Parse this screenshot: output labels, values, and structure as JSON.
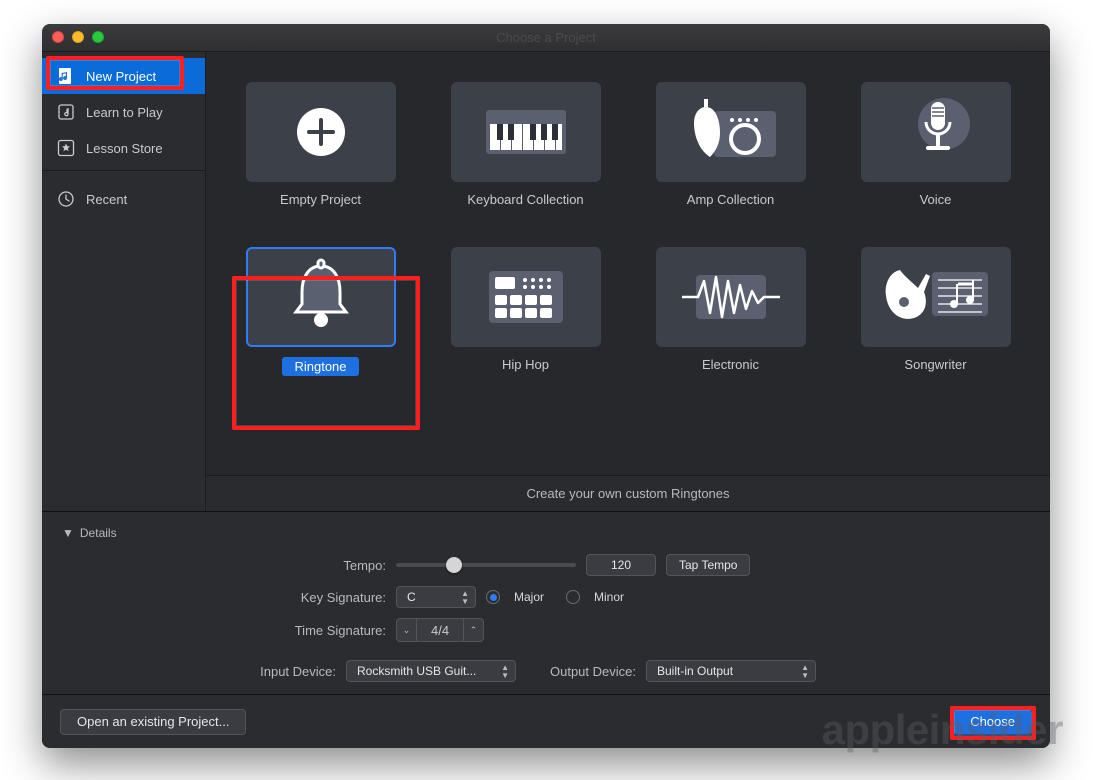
{
  "window": {
    "title": "Choose a Project"
  },
  "sidebar": {
    "items": [
      {
        "label": "New Project",
        "icon": "music-doc-icon",
        "active": true
      },
      {
        "label": "Learn to Play",
        "icon": "lesson-icon",
        "active": false
      },
      {
        "label": "Lesson Store",
        "icon": "star-icon",
        "active": false
      }
    ],
    "recent": [
      {
        "label": "Recent",
        "icon": "clock-icon"
      }
    ]
  },
  "templates": [
    {
      "label": "Empty Project",
      "icon": "plus-circle",
      "selected": false
    },
    {
      "label": "Keyboard Collection",
      "icon": "keyboard",
      "selected": false
    },
    {
      "label": "Amp Collection",
      "icon": "amp",
      "selected": false
    },
    {
      "label": "Voice",
      "icon": "microphone",
      "selected": false
    },
    {
      "label": "Ringtone",
      "icon": "bell",
      "selected": true
    },
    {
      "label": "Hip Hop",
      "icon": "drum-machine",
      "selected": false
    },
    {
      "label": "Electronic",
      "icon": "waveform",
      "selected": false
    },
    {
      "label": "Songwriter",
      "icon": "guitar-notes",
      "selected": false
    }
  ],
  "description": "Create your own custom Ringtones",
  "details": {
    "heading": "Details",
    "tempo_label": "Tempo:",
    "tempo_value": "120",
    "tempo_slider_pct": 28,
    "tap_label": "Tap Tempo",
    "key_label": "Key Signature:",
    "key_value": "C",
    "mode_major": "Major",
    "mode_minor": "Minor",
    "mode_selected": "major",
    "time_label": "Time Signature:",
    "time_value": "4/4",
    "input_label": "Input Device:",
    "input_value": "Rocksmith USB Guit...",
    "output_label": "Output Device:",
    "output_value": "Built-in Output"
  },
  "footer": {
    "open_existing": "Open an existing Project...",
    "choose": "Choose"
  },
  "watermark": "appleinsider"
}
